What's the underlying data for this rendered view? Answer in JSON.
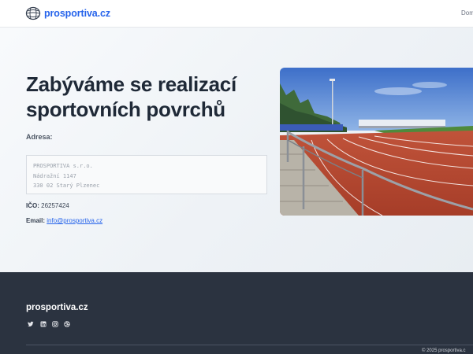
{
  "header": {
    "brand": "prosportiva.cz",
    "nav_item": "Dom"
  },
  "hero": {
    "title": "Zabýváme se realizací sportovních povrchů",
    "address_label": "Adresa:",
    "address_lines": [
      "PROSPORTIVA s.r.o.",
      "Nádražní 1147",
      "330 02 Starý Plzenec"
    ],
    "ico_label": "IČO:",
    "ico_value": "26257424",
    "email_label": "Email:",
    "email_value": "info@prosportiva.cz"
  },
  "footer": {
    "brand": "prosportiva.cz",
    "social_icons": [
      "twitter-icon",
      "linkedin-icon",
      "instagram-icon",
      "dribbble-icon"
    ],
    "copyright": "© 2025 prosportiva.c"
  },
  "colors": {
    "brand_blue": "#2563eb",
    "footer_bg": "#2b3340",
    "track_red": "#b5452e"
  }
}
